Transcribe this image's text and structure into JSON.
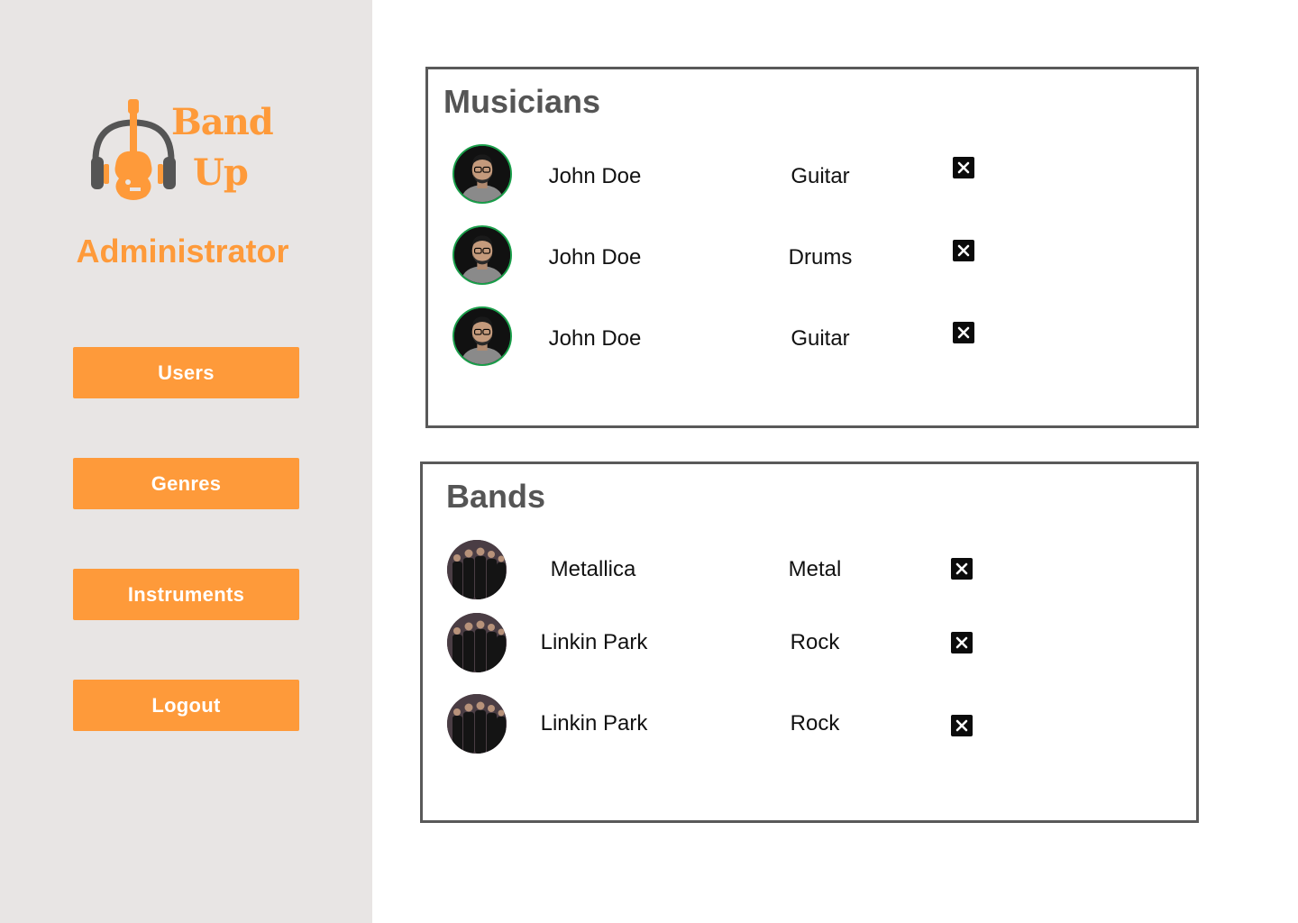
{
  "brand": {
    "word1": "Band",
    "word2": "Up",
    "role": "Administrator",
    "accent_color": "#fe9a3a",
    "logo_icon": "guitar-headphones-icon"
  },
  "nav": {
    "items": [
      {
        "label": "Users"
      },
      {
        "label": "Genres"
      },
      {
        "label": "Instruments"
      },
      {
        "label": "Logout"
      }
    ]
  },
  "musicians": {
    "title": "Musicians",
    "rows": [
      {
        "name": "John Doe",
        "instrument": "Guitar"
      },
      {
        "name": "John Doe",
        "instrument": "Drums"
      },
      {
        "name": "John Doe",
        "instrument": "Guitar"
      }
    ],
    "delete_icon": "close-box-icon"
  },
  "bands": {
    "title": "Bands",
    "rows": [
      {
        "name": "Metallica",
        "genre": "Metal"
      },
      {
        "name": "Linkin Park",
        "genre": "Rock"
      },
      {
        "name": "Linkin Park",
        "genre": "Rock"
      }
    ],
    "delete_icon": "close-box-icon"
  }
}
